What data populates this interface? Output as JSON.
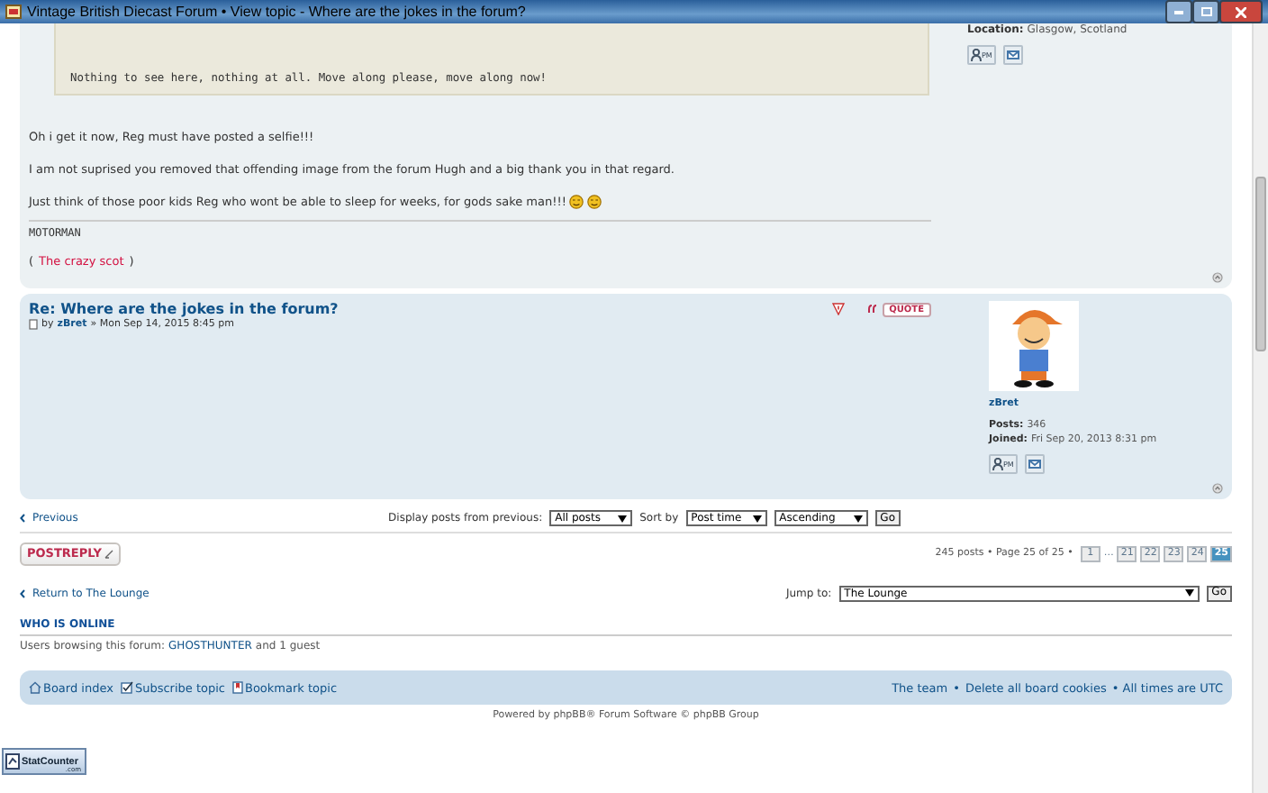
{
  "window": {
    "title": "Vintage British Diecast Forum • View topic - Where are the jokes in the forum?"
  },
  "post_1": {
    "quote_text": "Nothing to see here, nothing at all. Move along please, move along now!",
    "profile": {
      "location_label": "Location:",
      "location": "Glasgow, Scotland",
      "pm_label": "PM"
    },
    "paragraphs": [
      "Oh i get it now, Reg must have posted a selfie!!!",
      "I am not suprised you removed that offending image from the forum Hugh and a big thank you in that regard.",
      "Just think of those poor kids Reg who wont be able to sleep for weeks, for gods sake man!!!"
    ],
    "signature": "MOTORMAN",
    "signature_parts": [
      {
        "text": "(",
        "kind": "plain"
      },
      {
        "text": "The crazy scot",
        "kind": "link"
      },
      {
        "text": ")",
        "kind": "plain"
      }
    ]
  },
  "post_2": {
    "title": "Re: Where are the jokes in the forum?",
    "by": "by",
    "author": "zBret",
    "date": "» Mon Sep 14, 2015 8:45 pm",
    "quote_button": "QUOTE",
    "profile": {
      "username": "zBret",
      "posts_label": "Posts:",
      "posts": "346",
      "joined_label": "Joined:",
      "joined": "Fri Sep 20, 2013 8:31 pm",
      "pm_label": "PM"
    }
  },
  "topic_nav": {
    "previous": "Previous",
    "display_label": "Display posts from previous:",
    "display_value": "All posts",
    "sort_label": "Sort by",
    "sort_value": "Post time",
    "order_value": "Ascending",
    "go": "Go"
  },
  "actions": {
    "post_reply": "POSTREPLY",
    "summary": "245 posts • Page 25 of 25 •",
    "pages": [
      {
        "label": "1",
        "selected": false
      },
      {
        "label": "…",
        "kind": "gap",
        "selected": false
      },
      {
        "label": "21",
        "selected": false
      },
      {
        "label": "22",
        "selected": false
      },
      {
        "label": "23",
        "selected": false
      },
      {
        "label": "24",
        "selected": false
      },
      {
        "label": "25",
        "selected": true
      }
    ]
  },
  "jump": {
    "return": "Return to The Lounge",
    "label": "Jump to:",
    "value": "The Lounge",
    "go": "Go"
  },
  "who_is_online": {
    "heading": "WHO IS ONLINE",
    "prefix": "Users browsing this forum:",
    "user": "GHOSTHUNTER",
    "suffix": "and 1 guest"
  },
  "footer_bar": {
    "left": [
      {
        "label": "Board index",
        "kind": "home"
      },
      {
        "label": "Subscribe topic",
        "kind": "subscribe"
      },
      {
        "label": "Bookmark topic",
        "kind": "bookmark"
      }
    ],
    "links": [
      "The team",
      "Delete all board cookies"
    ],
    "separator": "•",
    "timezone": "• All times are UTC"
  },
  "powered_by": "Powered by phpBB® Forum Software © phpBB Group",
  "stat_counter": {
    "name": "StatCounter",
    "domain": ".com"
  }
}
